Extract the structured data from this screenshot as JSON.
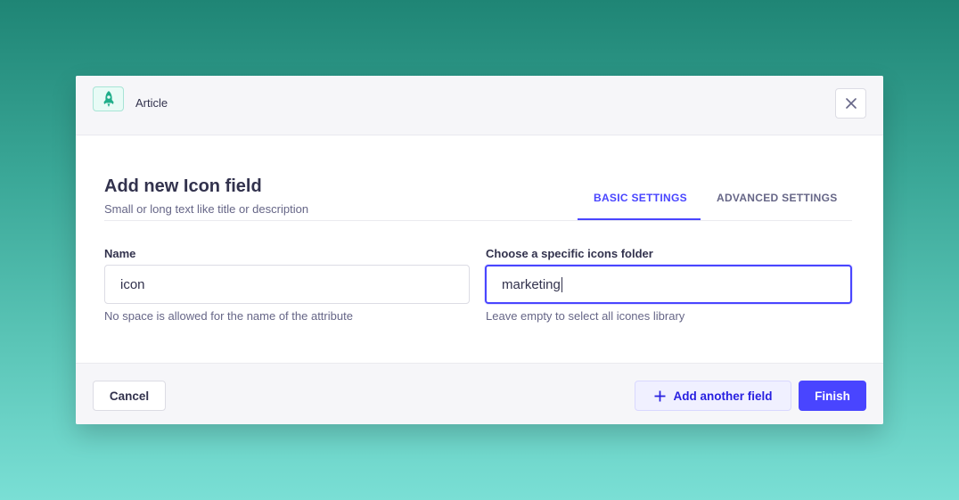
{
  "header": {
    "content_type": "Article",
    "type_icon": "rocket-icon",
    "close_icon": "close-icon"
  },
  "form": {
    "title": "Add new Icon field",
    "subtitle": "Small or long text like title or description",
    "tabs": [
      {
        "label": "BASIC SETTINGS",
        "active": true
      },
      {
        "label": "ADVANCED SETTINGS",
        "active": false
      }
    ],
    "name_field": {
      "label": "Name",
      "value": "icon",
      "hint": "No space is allowed for the name of the attribute"
    },
    "folder_field": {
      "label": "Choose a specific icons folder",
      "value": "marketing",
      "hint": "Leave empty to select all icones library",
      "focused": true
    }
  },
  "footer": {
    "cancel_label": "Cancel",
    "add_label": "Add another field",
    "add_icon": "plus-icon",
    "finish_label": "Finish"
  },
  "colors": {
    "primary": "#4945ff",
    "background_top": "#1f8575",
    "background_bottom": "#7adfd5",
    "icon_accent": "#1fae8a"
  }
}
